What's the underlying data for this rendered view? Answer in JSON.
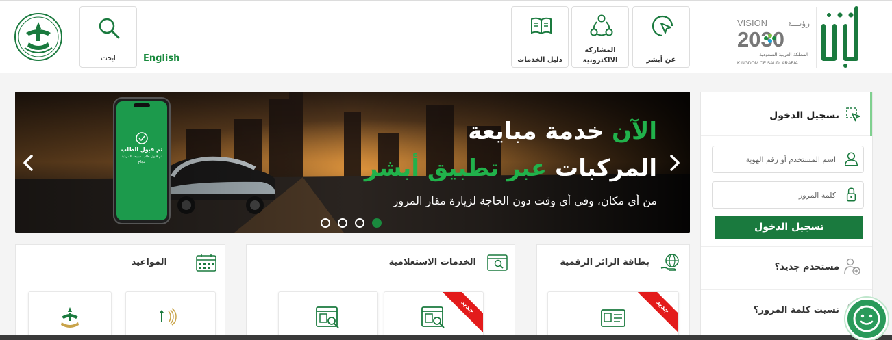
{
  "header": {
    "search_label": "ابحث",
    "english_label": "English",
    "nav": [
      {
        "label": "عن أبشر",
        "icon": "cursor-click-icon"
      },
      {
        "label": "المشاركة الالكترونية",
        "icon": "network-share-icon"
      },
      {
        "label": "دليل الخدمات",
        "icon": "book-icon"
      }
    ],
    "vision": {
      "vision_text": "VISION",
      "ruya_text": "رؤيـــة",
      "year": "2030",
      "kingdom_ar": "المملكة العربية السعودية",
      "kingdom_en": "KINGDOM OF SAUDI ARABIA"
    }
  },
  "hero": {
    "title1_green": "الآن",
    "title1_rest": "خدمة مبايعة",
    "title2_white": "المركبات",
    "title2_green": "عبر تطبيق أبشر",
    "subtitle": "من أي مكان، وفي أي وقت دون الحاجة لزيارة مقار المرور",
    "phone_title": "تم قبول الطلب",
    "phone_sub": "تم قبول طلب مبايعة المركبة بنجاح",
    "slide_count": 4,
    "active_slide": 4
  },
  "login": {
    "title": "تسجيل الدخول",
    "username_placeholder": "اسم المستخدم أو رقم الهوية",
    "password_placeholder": "كلمة المرور",
    "button_label": "تسجيل الدخول",
    "new_user": "مستخدم جديد؟",
    "forgot_password": "نسيت كلمة المرور؟"
  },
  "cards": [
    {
      "title": "بطاقة الزائر الرقمية",
      "icon": "globe-hand-icon"
    },
    {
      "title": "الخدمات الاستعلامية",
      "icon": "search-screen-icon"
    },
    {
      "title": "المواعيد",
      "icon": "calendar-icon"
    }
  ],
  "badge_new": "جديد",
  "colors": {
    "brand_green": "#1a7a3e",
    "accent_green": "#21b24b",
    "badge_red": "#e31b1b"
  }
}
